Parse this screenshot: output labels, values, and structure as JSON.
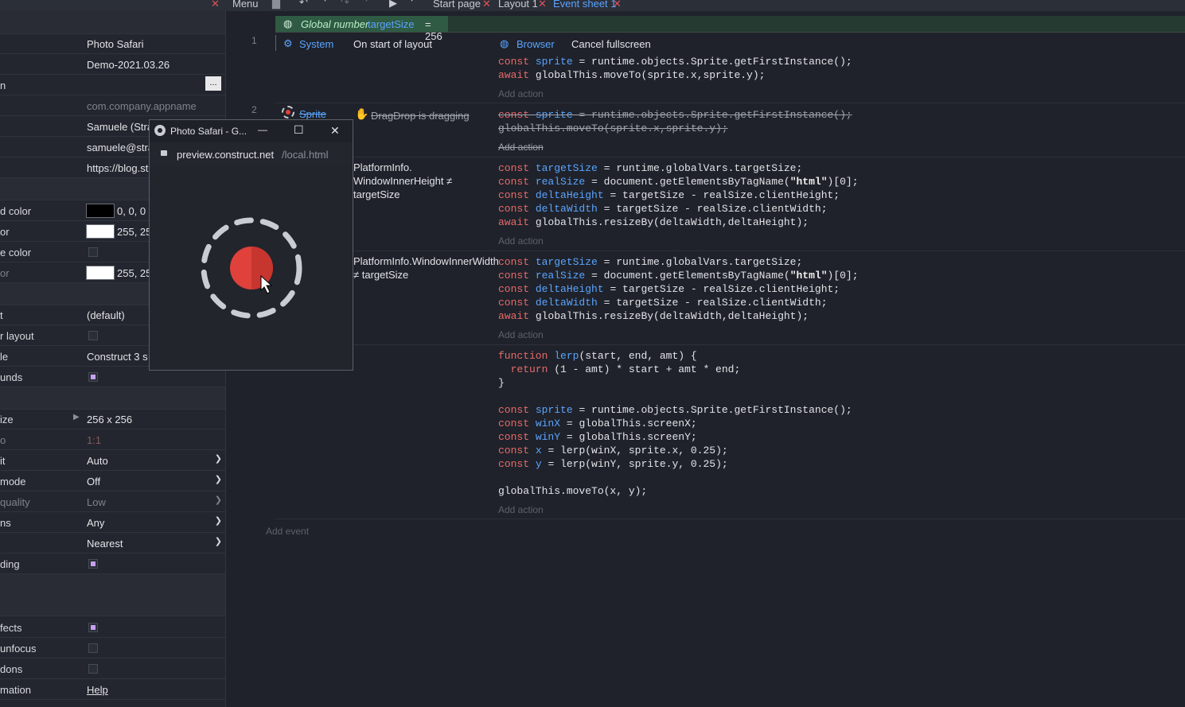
{
  "topbar": {
    "menu_label": "Menu",
    "tabs": [
      {
        "label": "Start page"
      },
      {
        "label": "Layout 1"
      },
      {
        "label": "Event sheet 1"
      }
    ]
  },
  "properties": {
    "rows": [
      {
        "label": "",
        "value": "Photo Safari"
      },
      {
        "label": "",
        "value": "Demo-2021.03.26"
      },
      {
        "label": "n",
        "value": ""
      },
      {
        "label": "",
        "value": "com.company.appname"
      },
      {
        "label": "",
        "value": "Samuele (Stra"
      },
      {
        "label": "",
        "value": "samuele@stra"
      },
      {
        "label": "",
        "value": "https://blog.st"
      },
      {
        "label": "d color",
        "value": "0, 0, 0"
      },
      {
        "label": "or",
        "value": "255, 25"
      },
      {
        "label": "e color",
        "value": ""
      },
      {
        "label": "or",
        "value": "255, 25"
      },
      {
        "label": "t",
        "value": "(default)"
      },
      {
        "label": "r layout",
        "value": ""
      },
      {
        "label": "le",
        "value": "Construct 3 s"
      },
      {
        "label": "unds",
        "value": ""
      },
      {
        "label": "ize",
        "value": "256 x 256"
      },
      {
        "label": "o",
        "value": "1:1"
      },
      {
        "label": "it",
        "value": "Auto"
      },
      {
        "label": "mode",
        "value": "Off"
      },
      {
        "label": "quality",
        "value": "Low"
      },
      {
        "label": "ns",
        "value": "Any"
      },
      {
        "label": "",
        "value": "Nearest"
      },
      {
        "label": "ding",
        "value": ""
      },
      {
        "label": "fects",
        "value": ""
      },
      {
        "label": "unfocus",
        "value": ""
      },
      {
        "label": "dons",
        "value": ""
      },
      {
        "label": "mation",
        "value": "Help"
      }
    ],
    "ellipsis_label": "..."
  },
  "sheet": {
    "global_label": "Global number",
    "global_var": "targetSize",
    "global_value": "= 256",
    "events": [
      {
        "number": "1",
        "object": "System",
        "condition": "On start of layout",
        "action_object": "Browser",
        "action": "Cancel fullscreen"
      },
      {
        "number": "2",
        "object": "Sprite",
        "condition": "DragDrop is dragging"
      },
      {
        "condition": "PlatformInfo. WindowInnerHeight ≠ targetSize"
      },
      {
        "condition": "PlatformInfo.WindowInnerWidth ≠ targetSize"
      }
    ],
    "add_action": "Add action",
    "add_event": "Add event"
  },
  "popup": {
    "title": "Photo Safari - G...",
    "url_host": "preview.construct.net",
    "url_path": "/local.html",
    "minimize": "—",
    "maximize": "☐",
    "close": "✕"
  },
  "colors": {
    "accent": "#5aa4ff",
    "keyword": "#e86a6a",
    "global_bg": "#2f5a43",
    "checkbox_on": "#c6a0f2",
    "spinner_red": "#e0413a",
    "spinner_gray": "#c9ccd2"
  },
  "icons": [
    "close-icon",
    "save-icon",
    "undo-icon",
    "redo-icon",
    "play-icon",
    "gear-icon",
    "globe-icon",
    "chrome-icon",
    "lock-icon",
    "cursor-icon"
  ]
}
